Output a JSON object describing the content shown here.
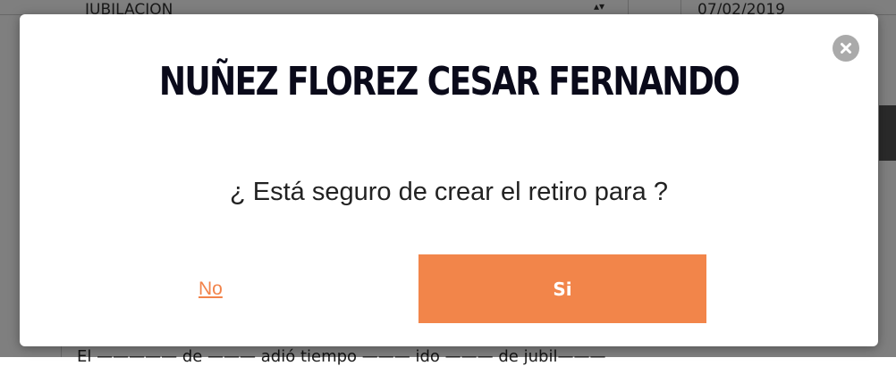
{
  "background": {
    "table_row": {
      "type": "JUBILACION",
      "date": "07/02/2019"
    },
    "footer_text": "El ————— de ——— adió tiempo ——— ido ——— de jubil———"
  },
  "modal": {
    "title": "NUÑEZ FLOREZ CESAR FERNANDO",
    "message": "¿ Está seguro de crear el retiro para ?",
    "close_icon": "close-icon",
    "no_label": "No",
    "si_label": "Si"
  },
  "colors": {
    "accent": "#f2854a",
    "overlay": "rgba(0,0,0,0.5)",
    "close_bg": "#aaaaaa"
  }
}
